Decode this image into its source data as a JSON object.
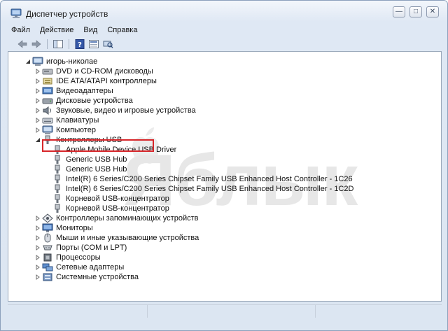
{
  "window": {
    "title": "Диспетчер устройств",
    "minimize": "—",
    "maximize": "□",
    "close": "✕"
  },
  "menu": [
    "Файл",
    "Действие",
    "Вид",
    "Справка"
  ],
  "watermark": {
    "text": "Яблык"
  },
  "tree": {
    "root": "игорь-николае",
    "categories": [
      {
        "label": "DVD и CD-ROM дисководы",
        "icon": "dvd-drive-icon"
      },
      {
        "label": "IDE ATA/ATAPI контроллеры",
        "icon": "ide-controller-icon"
      },
      {
        "label": "Видеоадаптеры",
        "icon": "display-adapter-icon"
      },
      {
        "label": "Дисковые устройства",
        "icon": "disk-drive-icon"
      },
      {
        "label": "Звуковые, видео и игровые устройства",
        "icon": "sound-icon"
      },
      {
        "label": "Клавиатуры",
        "icon": "keyboard-icon"
      },
      {
        "label": "Компьютер",
        "icon": "computer-icon"
      },
      {
        "label": "Контроллеры USB",
        "icon": "usb-controller-icon"
      }
    ],
    "usb_children": [
      "Apple Mobile Device USB Driver",
      "Generic USB Hub",
      "Generic USB Hub",
      "Intel(R) 6 Series/C200 Series Chipset Family USB Enhanced Host Controller - 1C26",
      "Intel(R) 6 Series/C200 Series Chipset Family USB Enhanced Host Controller - 1C2D",
      "Корневой USB-концентратор",
      "Корневой USB-концентратор"
    ],
    "categories_after": [
      {
        "label": "Контроллеры запоминающих устройств",
        "icon": "storage-controller-icon"
      },
      {
        "label": "Мониторы",
        "icon": "monitor-icon"
      },
      {
        "label": "Мыши и иные указывающие устройства",
        "icon": "mouse-icon"
      },
      {
        "label": "Порты (COM и LPT)",
        "icon": "port-icon"
      },
      {
        "label": "Процессоры",
        "icon": "processor-icon"
      },
      {
        "label": "Сетевые адаптеры",
        "icon": "network-adapter-icon"
      },
      {
        "label": "Системные устройства",
        "icon": "system-devices-icon"
      }
    ]
  },
  "colors": {
    "highlight": "#d7262a"
  }
}
